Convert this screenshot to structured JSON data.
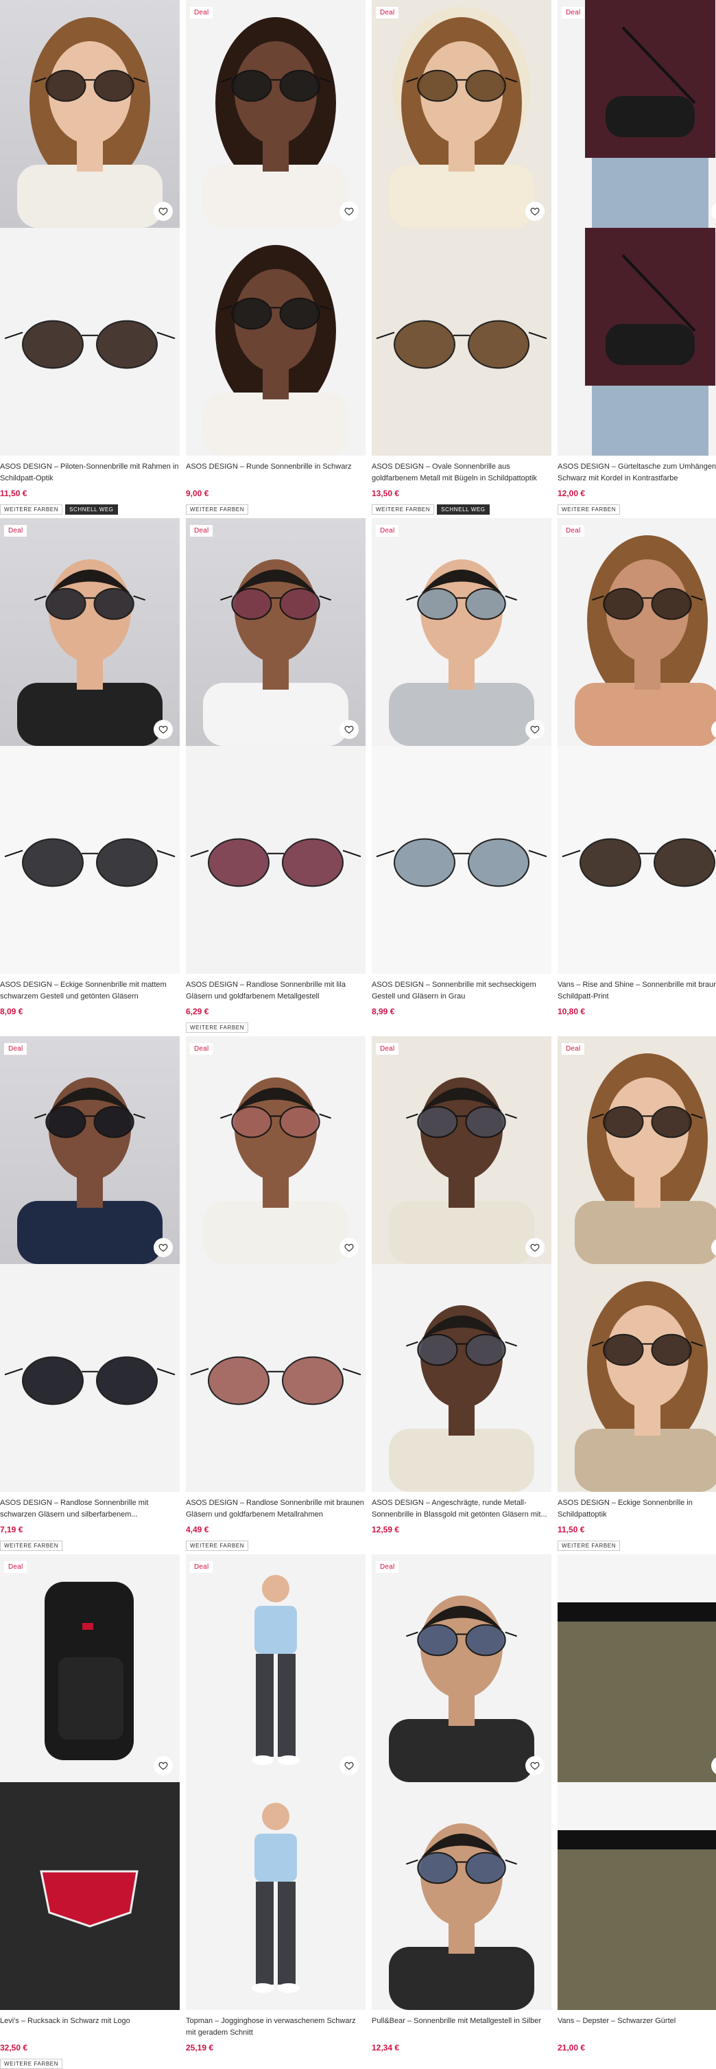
{
  "labels": {
    "deal": "Deal",
    "more_colors": "WEITERE FARBEN",
    "selling_fast": "SCHNELL WEG"
  },
  "products": [
    {
      "title": "ASOS DESIGN – Piloten-Sonnenbrille mit Rahmen in Schildpatt-Optik",
      "price": "11,50 €",
      "deal": false,
      "tags": [
        "more_colors",
        "selling_fast"
      ],
      "main_photo": "model-woman-sunglasses",
      "hover_photo": "sunglasses-product"
    },
    {
      "title": "ASOS DESIGN – Runde Sonnenbrille in Schwarz",
      "price": "9,00 €",
      "deal": true,
      "tags": [
        "more_colors"
      ],
      "main_photo": "model-woman-sunglasses",
      "hover_photo": "model-woman-sunglasses"
    },
    {
      "title": "ASOS DESIGN – Ovale Sonnenbrille aus goldfarbenem Metall mit Bügeln in Schildpattoptik",
      "price": "13,50 €",
      "deal": true,
      "tags": [
        "more_colors",
        "selling_fast"
      ],
      "main_photo": "model-woman-hood-sunglasses",
      "hover_photo": "sunglasses-product"
    },
    {
      "title": "ASOS DESIGN – Gürteltasche zum Umhängen in Schwarz mit Kordel in Kontrastfarbe",
      "price": "12,00 €",
      "deal": true,
      "tags": [
        "more_colors"
      ],
      "main_photo": "model-man-belt-bag",
      "hover_photo": "belt-bag-product"
    },
    {
      "title": "ASOS DESIGN – Eckige Sonnenbrille mit mattem schwarzem Gestell und getönten Gläsern",
      "price": "8,09 €",
      "deal": true,
      "tags": [],
      "main_photo": "model-man-sunglasses",
      "hover_photo": "sunglasses-product"
    },
    {
      "title": "ASOS DESIGN – Randlose Sonnenbrille mit lila Gläsern und goldfarbenem Metallgestell",
      "price": "6,29 €",
      "deal": true,
      "tags": [
        "more_colors"
      ],
      "main_photo": "model-man-sunglasses",
      "hover_photo": "sunglasses-product"
    },
    {
      "title": "ASOS DESIGN – Sonnenbrille mit sechseckigem Gestell und Gläsern in Grau",
      "price": "8,99 €",
      "deal": true,
      "tags": [],
      "main_photo": "model-man-sunglasses",
      "hover_photo": "sunglasses-product"
    },
    {
      "title": "Vans – Rise and Shine – Sonnenbrille mit braunem Schildpatt-Print",
      "price": "10,80 €",
      "deal": true,
      "tags": [],
      "main_photo": "model-woman-sunglasses",
      "hover_photo": "sunglasses-product"
    },
    {
      "title": "ASOS DESIGN – Randlose Sonnenbrille mit schwarzen Gläsern und silberfarbenem...",
      "price": "7,19 €",
      "deal": true,
      "tags": [
        "more_colors"
      ],
      "main_photo": "model-man-sunglasses",
      "hover_photo": "sunglasses-product"
    },
    {
      "title": "ASOS DESIGN – Randlose Sonnenbrille mit braunen Gläsern und goldfarbenem Metallrahmen",
      "price": "4,49 €",
      "deal": true,
      "tags": [
        "more_colors"
      ],
      "main_photo": "model-man-sunglasses",
      "hover_photo": "sunglasses-product"
    },
    {
      "title": "ASOS DESIGN – Angeschrägte, runde Metall-Sonnenbrille in Blassgold mit getönten Gläsern mit...",
      "price": "12,59 €",
      "deal": true,
      "tags": [],
      "main_photo": "model-man-sunglasses",
      "hover_photo": "model-man-sunglasses"
    },
    {
      "title": "ASOS DESIGN – Eckige Sonnenbrille in Schildpattoptik",
      "price": "11,50 €",
      "deal": true,
      "tags": [
        "more_colors"
      ],
      "main_photo": "model-woman-sunglasses",
      "hover_photo": "model-woman-sunglasses"
    },
    {
      "title": "Levi's – Rucksack in Schwarz mit Logo",
      "price": "32,50 €",
      "deal": true,
      "tags": [
        "more_colors"
      ],
      "main_photo": "backpack-product",
      "hover_photo": "backpack-logo-closeup"
    },
    {
      "title": "Topman – Jogginghose in verwaschenem Schwarz mit geradem Schnitt",
      "price": "25,19 €",
      "deal": true,
      "tags": [],
      "main_photo": "model-man-joggers",
      "hover_photo": "model-man-joggers"
    },
    {
      "title": "Pull&Bear – Sonnenbrille mit Metallgestell in Silber",
      "price": "12,34 €",
      "deal": true,
      "tags": [],
      "main_photo": "model-man-sunglasses",
      "hover_photo": "model-man-sunglasses"
    },
    {
      "title": "Vans – Depster – Schwarzer Gürtel",
      "price": "21,00 €",
      "deal": false,
      "tags": [],
      "main_photo": "model-belt",
      "hover_photo": "model-belt"
    }
  ]
}
